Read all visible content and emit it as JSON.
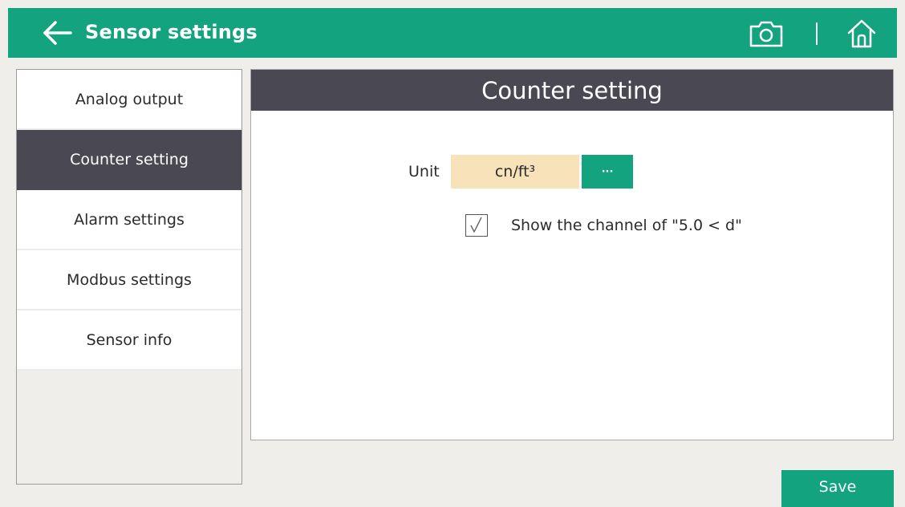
{
  "header": {
    "title": "Sensor settings",
    "back_icon": "arrow-left-icon",
    "camera_icon": "camera-icon",
    "home_icon": "home-icon",
    "bg_color": "#14a37f"
  },
  "sidebar": {
    "items": [
      {
        "label": "Analog output",
        "active": false
      },
      {
        "label": "Counter setting",
        "active": true
      },
      {
        "label": "Alarm settings",
        "active": false
      },
      {
        "label": "Modbus settings",
        "active": false
      },
      {
        "label": "Sensor info",
        "active": false
      }
    ],
    "active_color": "#4a4953"
  },
  "panel": {
    "title": "Counter setting",
    "unit_label": "Unit",
    "unit_value": "cn/ft³",
    "more_label": "···",
    "checkbox_label": "Show the channel of \"5.0 < d\"",
    "checkbox_checked": true
  },
  "footer": {
    "save_label": "Save"
  }
}
